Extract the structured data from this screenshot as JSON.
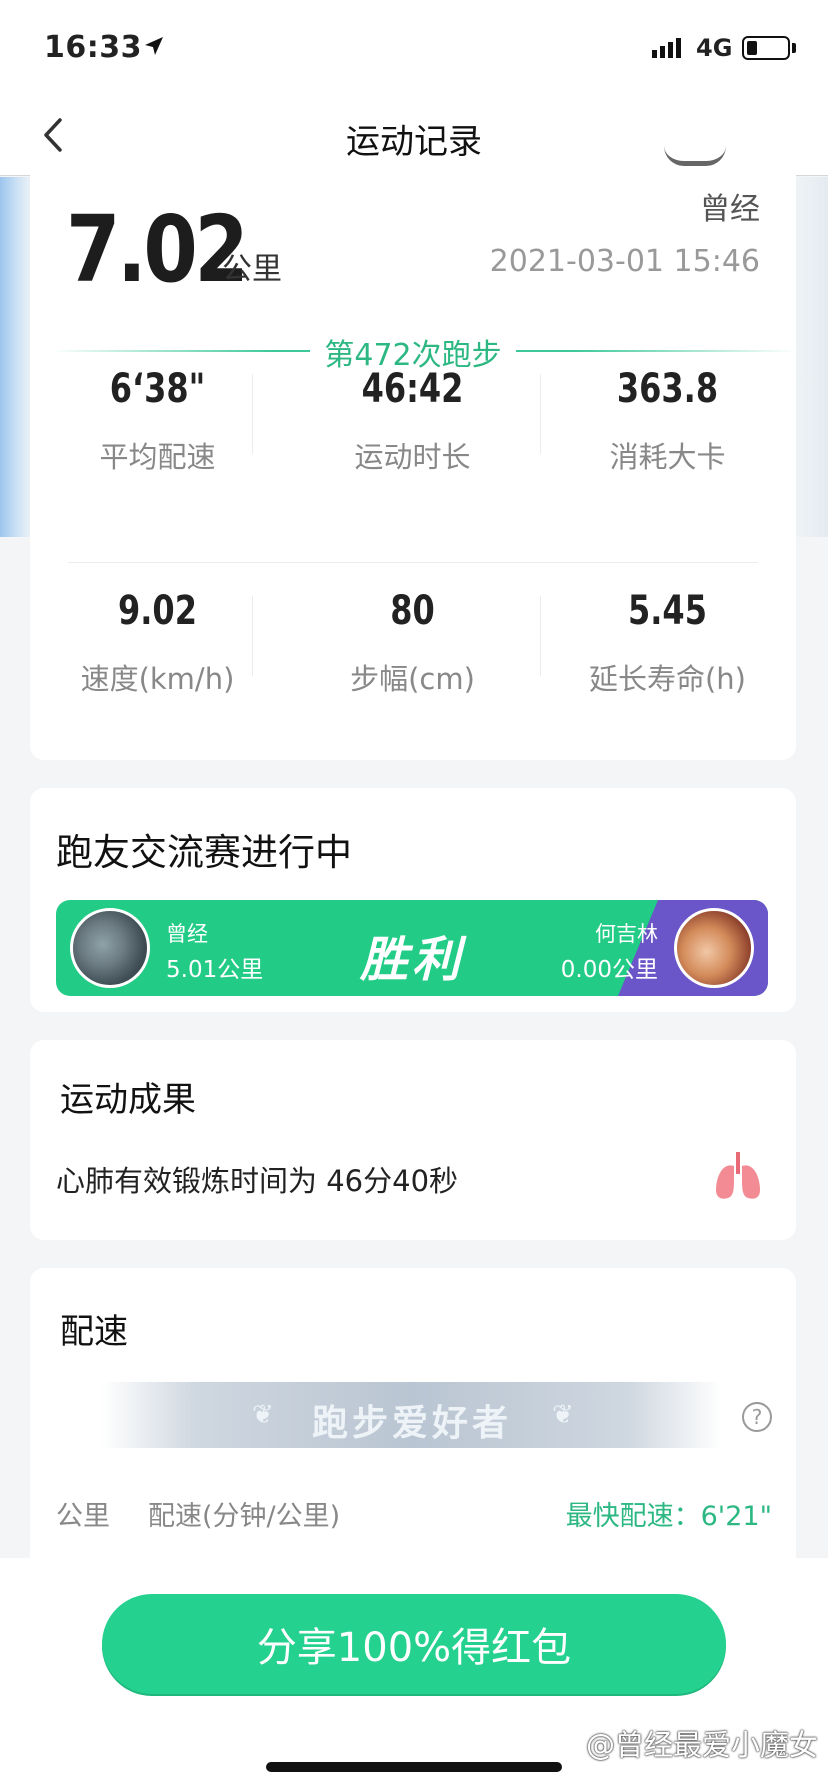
{
  "status_bar": {
    "time": "16:33",
    "network": "4G"
  },
  "nav": {
    "title": "运动记录"
  },
  "summary": {
    "distance": "7.02",
    "distance_unit": "公里",
    "user_name": "曾经",
    "date": "2021-03-01 15:46",
    "run_count": "第472次跑步",
    "stats": [
      {
        "value": "6‘38\"",
        "label": "平均配速"
      },
      {
        "value": "46:42",
        "label": "运动时长"
      },
      {
        "value": "363.8",
        "label": "消耗大卡"
      },
      {
        "value": "9.02",
        "label": "速度(km/h)"
      },
      {
        "value": "80",
        "label": "步幅(cm)"
      },
      {
        "value": "5.45",
        "label": "延长寿命(h)"
      }
    ]
  },
  "competition": {
    "title": "跑友交流赛进行中",
    "left_name": "曾经",
    "left_distance": "5.01公里",
    "result": "胜利",
    "right_name": "何吉林",
    "right_distance": "0.00公里"
  },
  "achievement": {
    "title": "运动成果",
    "text": "心肺有效锻炼时间为 46分40秒",
    "icon": "lungs-icon"
  },
  "pace": {
    "title": "配速",
    "badge": "跑步爱好者",
    "col_km": "公里",
    "col_pace": "配速(分钟/公里)",
    "fastest": "最快配速：6'21\""
  },
  "share_button": "分享100%得红包",
  "watermark": "@曾经最爱小魔女",
  "colors": {
    "accent": "#24d18e",
    "green_text": "#2db883",
    "purple": "#6a55c9"
  }
}
